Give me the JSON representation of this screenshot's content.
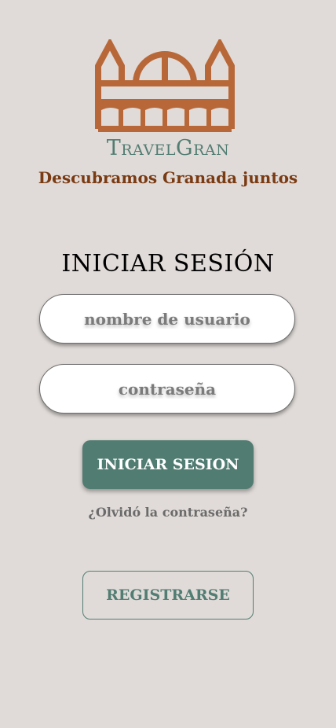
{
  "brand": {
    "name": "TravelGran",
    "tagline": "Descubramos Granada juntos",
    "logo_icon": "granada-monument-icon",
    "logo_color": "#b86838",
    "name_color": "#527d72",
    "tagline_color": "#7a3a12"
  },
  "login": {
    "title": "INICIAR SESIÓN",
    "username_placeholder": "nombre de usuario",
    "password_placeholder": "contraseña",
    "submit_label": "INICIAR SESION",
    "forgot_label": "¿Olvidó la contraseña?",
    "register_label": "REGISTRARSE",
    "accent_color": "#517c72"
  }
}
